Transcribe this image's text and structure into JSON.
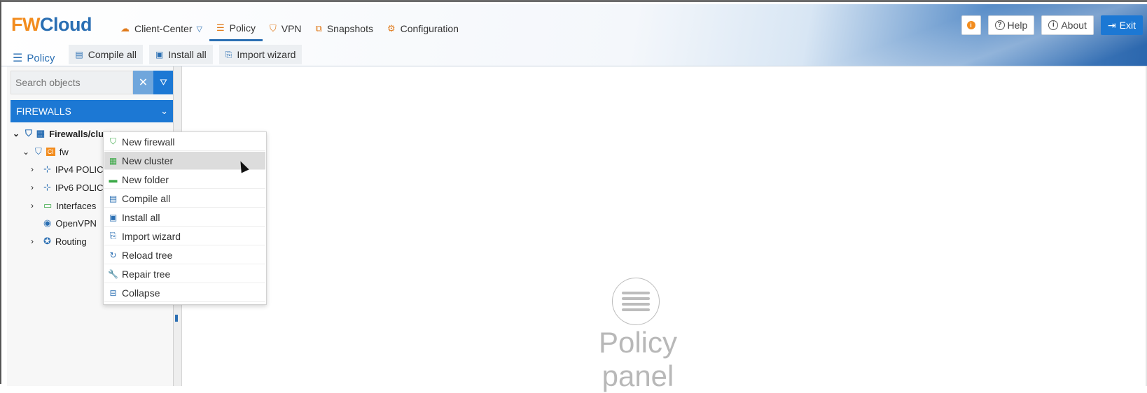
{
  "app": {
    "logo_fw": "FW",
    "logo_cloud": "Cloud"
  },
  "nav": {
    "items": [
      {
        "label": "Client-Center",
        "icon": "cloud-icon"
      },
      {
        "label": "Policy",
        "icon": "list-icon"
      },
      {
        "label": "VPN",
        "icon": "shield-icon"
      },
      {
        "label": "Snapshots",
        "icon": "snapshot-icon"
      },
      {
        "label": "Configuration",
        "icon": "gear-icon"
      }
    ],
    "active": "Policy"
  },
  "top_buttons": {
    "info_label": "i",
    "help_label": "Help",
    "about_label": "About",
    "exit_label": "Exit"
  },
  "subbar": {
    "title": "Policy",
    "compile_all": "Compile all",
    "install_all": "Install all",
    "import_wizard": "Import wizard"
  },
  "search": {
    "placeholder": "Search objects"
  },
  "firewalls_header": "FIREWALLS",
  "tree": {
    "root": "Firewalls/clusters",
    "fw": "fw",
    "fw_badge": "CI",
    "ipv4": "IPv4 POLICY",
    "ipv6": "IPv6 POLICY",
    "interfaces": "Interfaces",
    "openvpn": "OpenVPN",
    "routing": "Routing"
  },
  "context_menu": {
    "items": [
      {
        "label": "New firewall",
        "icon": "shield-icon"
      },
      {
        "label": "New cluster",
        "icon": "cluster-icon"
      },
      {
        "label": "New folder",
        "icon": "folder-icon"
      },
      {
        "label": "Compile all",
        "icon": "compile-icon"
      },
      {
        "label": "Install all",
        "icon": "install-icon"
      },
      {
        "label": "Import wizard",
        "icon": "import-icon"
      },
      {
        "label": "Reload tree",
        "icon": "reload-icon"
      },
      {
        "label": "Repair tree",
        "icon": "wrench-icon"
      },
      {
        "label": "Collapse",
        "icon": "collapse-icon"
      }
    ],
    "hovered": "New cluster"
  },
  "main": {
    "panel_title": "Policy panel"
  }
}
